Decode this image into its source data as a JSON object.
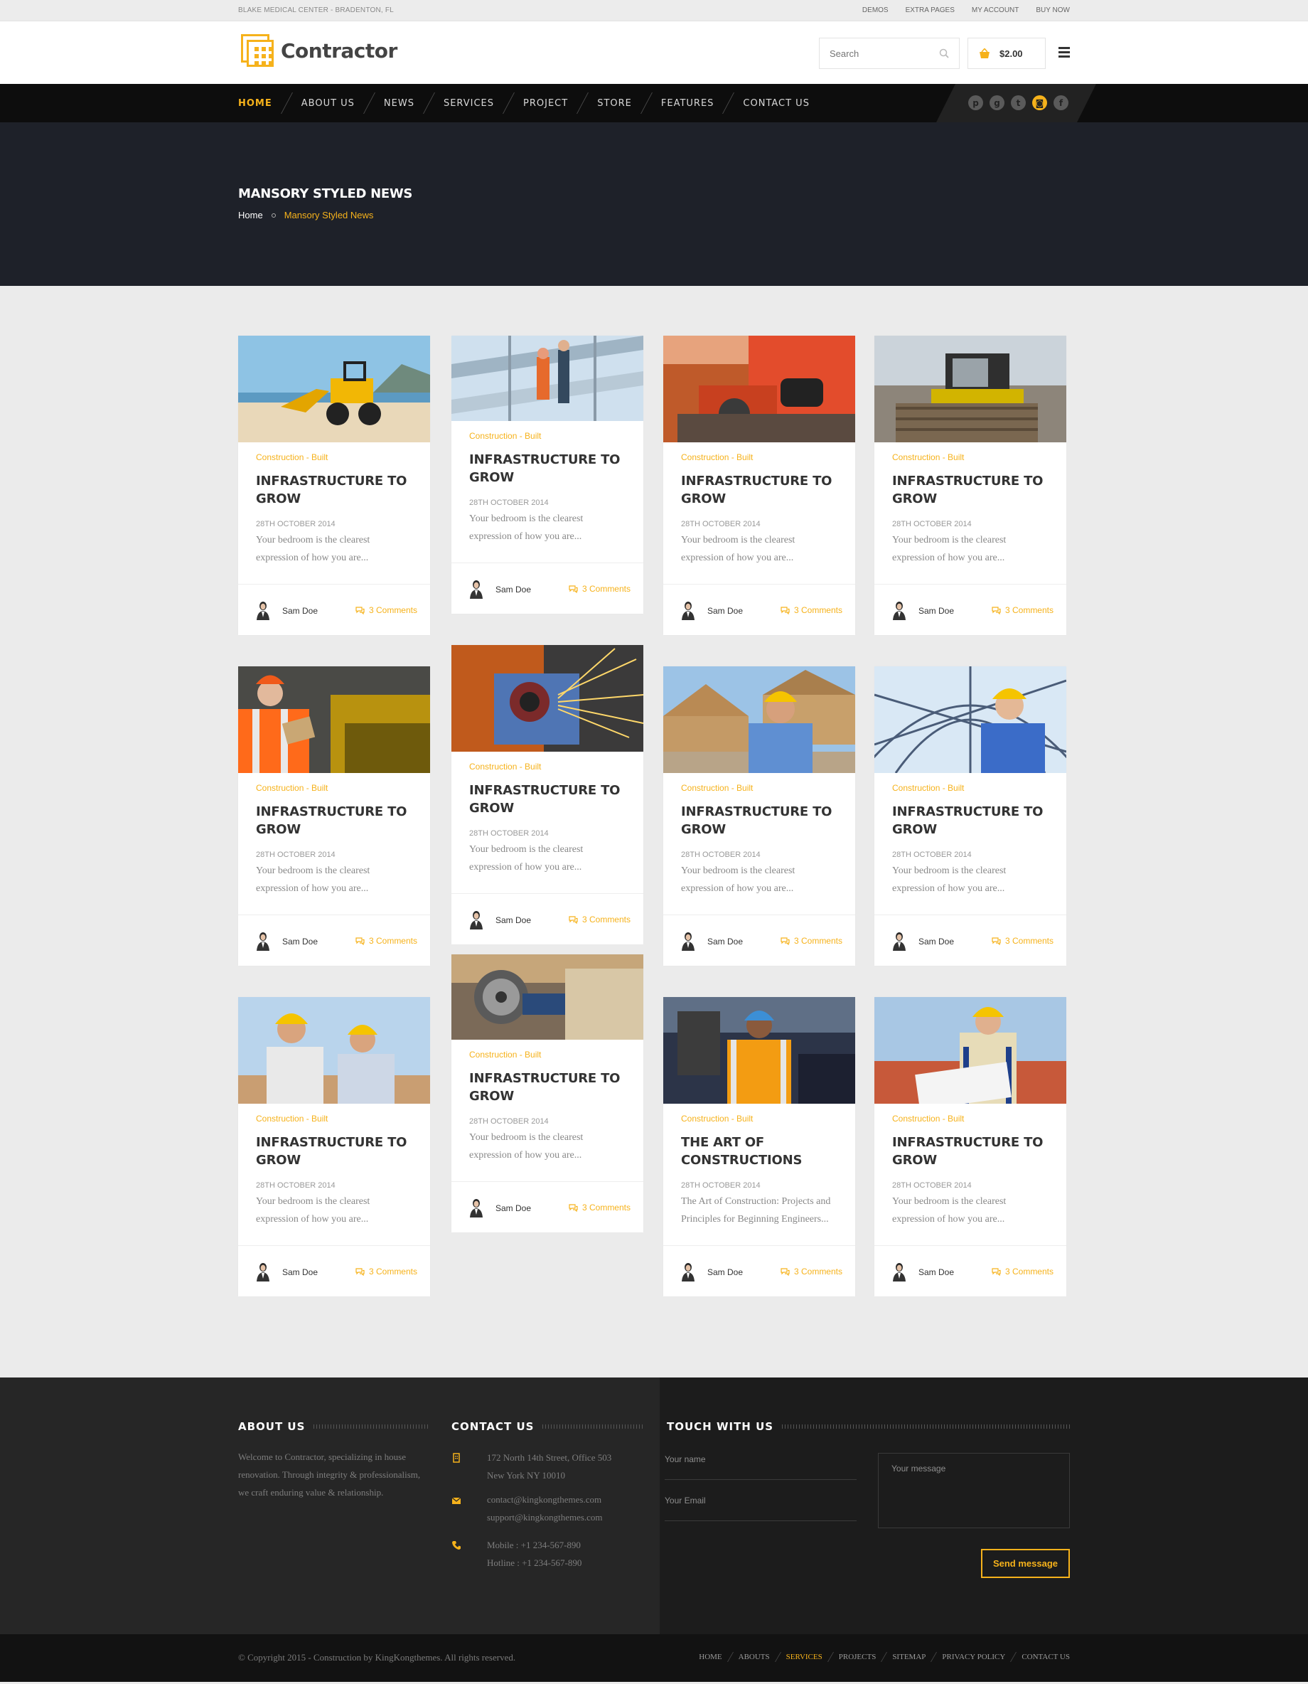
{
  "topbar": {
    "location": "BLAKE MEDICAL CENTER - BRADENTON, FL",
    "links": [
      "DEMOS",
      "EXTRA PAGES",
      "MY ACCOUNT",
      "BUY NOW"
    ]
  },
  "header": {
    "logo_text": "Contractor",
    "search_placeholder": "Search",
    "cart_total": "$2.00"
  },
  "nav": {
    "items": [
      "HOME",
      "ABOUT US",
      "NEWS",
      "SERVICES",
      "PROJECT",
      "STORE",
      "FEATURES",
      "CONTACT US"
    ],
    "active": "HOME",
    "social": [
      {
        "icon": "pinterest-icon",
        "glyph": "p"
      },
      {
        "icon": "google-plus-icon",
        "glyph": "g"
      },
      {
        "icon": "twitter-icon",
        "glyph": "t"
      },
      {
        "icon": "instagram-icon",
        "glyph": "◙"
      },
      {
        "icon": "facebook-icon",
        "glyph": "f"
      }
    ],
    "social_active": "instagram-icon"
  },
  "hero": {
    "title": "MANSORY STYLED NEWS",
    "breadcrumb_home": "Home",
    "breadcrumb_current": "Mansory Styled News"
  },
  "posts": [
    {
      "category_a": "Construction",
      "category_sep": " - ",
      "category_b": "Built",
      "title": "INFRASTRUCTURE TO GROW",
      "date": "28TH OCTOBER 2014",
      "excerpt": "Your bedroom is the clearest expression of how you are...",
      "author": "Sam Doe",
      "comments": "3 Comments",
      "image": "bulldozer-on-beach"
    },
    {
      "category_a": "Construction",
      "category_sep": " - ",
      "category_b": "Built",
      "title": "INFRASTRUCTURE TO GROW",
      "date": "28TH OCTOBER 2014",
      "excerpt": "Your bedroom is the clearest expression of how you are...",
      "author": "Sam Doe",
      "comments": "3 Comments",
      "image": "workers-on-scaffold"
    },
    {
      "category_a": "Construction",
      "category_sep": " - ",
      "category_b": "Built",
      "title": "INFRASTRUCTURE TO GROW",
      "date": "28TH OCTOBER 2014",
      "excerpt": "Your bedroom is the clearest expression of how you are...",
      "author": "Sam Doe",
      "comments": "3 Comments",
      "image": "worker-with-tool"
    },
    {
      "category_a": "Construction",
      "category_sep": " - ",
      "category_b": "Built",
      "title": "INFRASTRUCTURE TO GROW",
      "date": "28TH OCTOBER 2014",
      "excerpt": "Your bedroom is the clearest expression of how you are...",
      "author": "Sam Doe",
      "comments": "3 Comments",
      "image": "skid-loader"
    },
    {
      "category_a": "Construction",
      "category_sep": " - ",
      "category_b": "Built",
      "title": "INFRASTRUCTURE TO GROW",
      "date": "28TH OCTOBER 2014",
      "excerpt": "Your bedroom is the clearest expression of how you are...",
      "author": "Sam Doe",
      "comments": "3 Comments",
      "image": "inspector-with-tablet"
    },
    {
      "category_a": "Construction",
      "category_sep": " - ",
      "category_b": "Built",
      "title": "INFRASTRUCTURE TO GROW",
      "date": "28TH OCTOBER 2014",
      "excerpt": "Your bedroom is the clearest expression of how you are...",
      "author": "Sam Doe",
      "comments": "3 Comments",
      "image": "grinder-sparks"
    },
    {
      "category_a": "Construction",
      "category_sep": " - ",
      "category_b": "Built",
      "title": "INFRASTRUCTURE TO GROW",
      "date": "28TH OCTOBER 2014",
      "excerpt": "Your bedroom is the clearest expression of how you are...",
      "author": "Sam Doe",
      "comments": "3 Comments",
      "image": "worker-at-house-frame"
    },
    {
      "category_a": "Construction",
      "category_sep": " - ",
      "category_b": "Built",
      "title": "INFRASTRUCTURE TO GROW",
      "date": "28TH OCTOBER 2014",
      "excerpt": "Your bedroom is the clearest expression of how you are...",
      "author": "Sam Doe",
      "comments": "3 Comments",
      "image": "engineer-under-dome"
    },
    {
      "category_a": "Construction",
      "category_sep": " - ",
      "category_b": "Built",
      "title": "INFRASTRUCTURE TO GROW",
      "date": "28TH OCTOBER 2014",
      "excerpt": "Your bedroom is the clearest expression of how you are...",
      "author": "Sam Doe",
      "comments": "3 Comments",
      "image": "two-workers-helmets"
    },
    {
      "category_a": "Construction",
      "category_sep": " - ",
      "category_b": "Built",
      "title": "INFRASTRUCTURE TO GROW",
      "date": "28TH OCTOBER 2014",
      "excerpt": "Your bedroom is the clearest expression of how you are...",
      "author": "Sam Doe",
      "comments": "3 Comments",
      "image": "angle-grinder-closeup"
    },
    {
      "category_a": "Construction",
      "category_sep": " - ",
      "category_b": "Built",
      "title": "THE ART OF CONSTRUCTIONS",
      "date": "28TH OCTOBER 2014",
      "excerpt": "The Art of Construction: Projects and Principles for Beginning Engineers...",
      "author": "Sam Doe",
      "comments": "3 Comments",
      "image": "worker-safety-vest"
    },
    {
      "category_a": "Construction",
      "category_sep": " - ",
      "category_b": "Built",
      "title": "INFRASTRUCTURE TO GROW",
      "date": "28TH OCTOBER 2014",
      "excerpt": "Your bedroom is the clearest expression of how you are...",
      "author": "Sam Doe",
      "comments": "3 Comments",
      "image": "worker-reading-plans"
    }
  ],
  "footer": {
    "about_title": "ABOUT US",
    "about_text": "Welcome to Contractor, specializing in house renovation. Through integrity & professionalism, we craft enduring value & relationship.",
    "contact_title": "CONTACT US",
    "address_1": "172 North 14th Street, Office 503",
    "address_2": "New York NY 10010",
    "email_1": "contact@kingkongthemes.com",
    "email_2": "support@kingkongthemes.com",
    "mobile": "Mobile : +1 234-567-890",
    "hotline": "Hotline : +1 234-567-890",
    "touch_title": "TOUCH WITH US",
    "name_placeholder": "Your name",
    "email_placeholder": "Your Email",
    "message_placeholder": "Your message",
    "send_label": "Send message"
  },
  "bottom": {
    "copyright": "© Copyright 2015 - Construction by KingKongthemes. All rights reserved.",
    "links": [
      "HOME",
      "ABOUTS",
      "SERVICES",
      "PROJECTS",
      "SITEMAP",
      "PRIVACY POLICY",
      "CONTACT US"
    ],
    "active": "SERVICES"
  },
  "colors": {
    "accent": "#f6b21b",
    "dark": "#0d0d0d",
    "hero": "#1e2129"
  }
}
